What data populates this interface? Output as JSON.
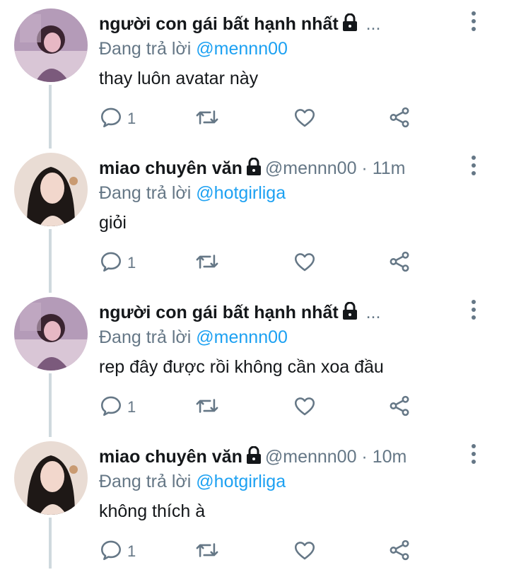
{
  "colors": {
    "accent": "#1da1f2",
    "muted": "#657786",
    "text": "#14171a",
    "thread_line": "#cfd9de"
  },
  "icons": {
    "reply": "reply-icon",
    "retweet": "retweet-icon",
    "like": "heart-icon",
    "share": "share-icon",
    "lock": "lock-icon",
    "more": "more-vertical-icon"
  },
  "tweets": [
    {
      "name": "người con gái bất hạnh nhất",
      "handle_suffix": " ...",
      "reply_prefix": "Đang trả lời ",
      "reply_mention": "@mennn00",
      "text": "thay luôn avatar này",
      "reply_count": "1"
    },
    {
      "name": "miao chuyên văn",
      "handle_suffix": "@mennn00 · 11m",
      "reply_prefix": "Đang trả lời ",
      "reply_mention": "@hotgirliga",
      "text": "giỏi",
      "reply_count": "1"
    },
    {
      "name": "người con gái bất hạnh nhất",
      "handle_suffix": " ...",
      "reply_prefix": "Đang trả lời ",
      "reply_mention": "@mennn00",
      "text": "rep đây được rồi không cần xoa đầu",
      "reply_count": "1"
    },
    {
      "name": "miao chuyên văn",
      "handle_suffix": "@mennn00 · 10m",
      "reply_prefix": "Đang trả lời ",
      "reply_mention": "@hotgirliga",
      "text": "không thích à",
      "reply_count": "1"
    }
  ]
}
